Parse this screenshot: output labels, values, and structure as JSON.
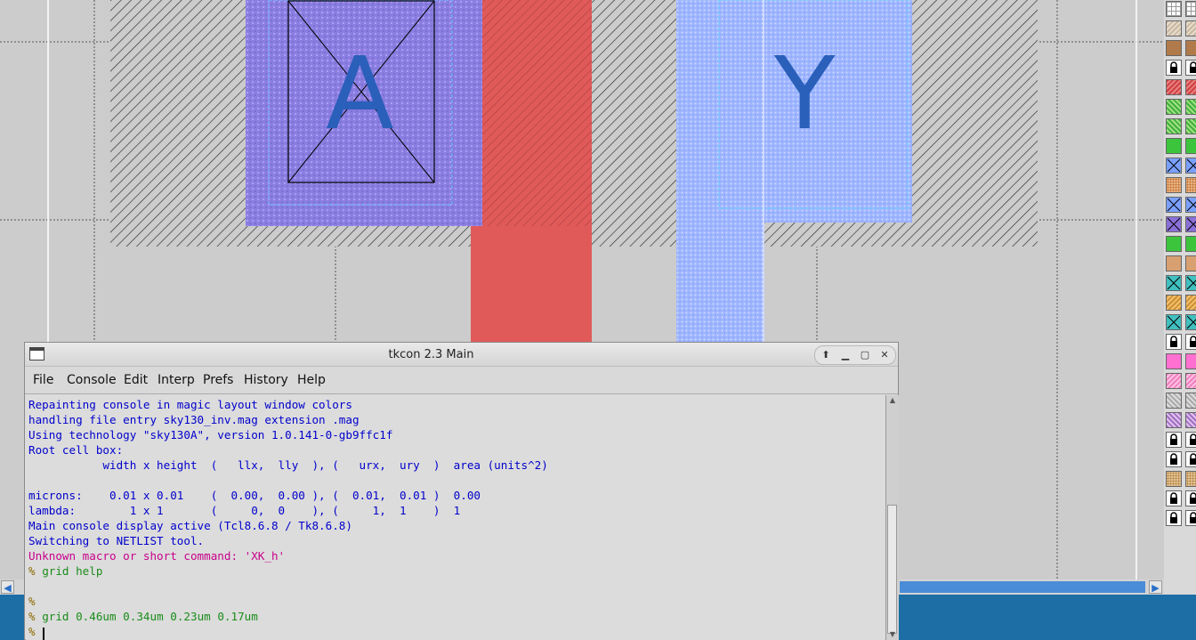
{
  "layout": {
    "labels": {
      "pin_a": "A",
      "pin_y": "Y"
    },
    "colors": {
      "background": "#cccccc",
      "poly": "#e05a5a",
      "metal1": "#aab8ff",
      "li": "#8877dd",
      "text": "#2a5fba"
    }
  },
  "palette": {
    "tiles": [
      {
        "kind": "grid-icon"
      },
      {
        "kind": "hatch-tan"
      },
      {
        "kind": "brown"
      },
      {
        "kind": "lock-icon"
      },
      {
        "kind": "red-hatch"
      },
      {
        "kind": "green-hatch"
      },
      {
        "kind": "green-hatch"
      },
      {
        "kind": "green"
      },
      {
        "kind": "blue-x"
      },
      {
        "kind": "orange-dots"
      },
      {
        "kind": "blue-x"
      },
      {
        "kind": "purple-x"
      },
      {
        "kind": "green"
      },
      {
        "kind": "tan"
      },
      {
        "kind": "teal-x"
      },
      {
        "kind": "orange-hatch"
      },
      {
        "kind": "teal-x"
      },
      {
        "kind": "lock-icon"
      },
      {
        "kind": "pink"
      },
      {
        "kind": "pink-hatch"
      },
      {
        "kind": "grey-hatch"
      },
      {
        "kind": "purple-hatch"
      },
      {
        "kind": "lock-icon"
      },
      {
        "kind": "lock-icon"
      },
      {
        "kind": "tan-dots"
      },
      {
        "kind": "lock-icon"
      },
      {
        "kind": "lock-icon"
      }
    ]
  },
  "tkcon": {
    "title": "tkcon 2.3 Main",
    "menu": [
      "File",
      "Console",
      "Edit",
      "Interp",
      "Prefs",
      "History",
      "Help"
    ],
    "lines": [
      {
        "text": "Repainting console in magic layout window colors",
        "style": "info"
      },
      {
        "text": "handling file entry sky130_inv.mag extension .mag",
        "style": "info"
      },
      {
        "text": "Using technology \"sky130A\", version 1.0.141-0-gb9ffc1f",
        "style": "info"
      },
      {
        "text": "Root cell box:",
        "style": "info"
      },
      {
        "text": "           width x height  (   llx,  lly  ), (   urx,  ury  )  area (units^2)",
        "style": "info"
      },
      {
        "text": "",
        "style": "info"
      },
      {
        "text": "microns:    0.01 x 0.01    (  0.00,  0.00 ), (  0.01,  0.01 )  0.00",
        "style": "info"
      },
      {
        "text": "lambda:        1 x 1       (     0,  0    ), (     1,  1    )  1",
        "style": "info"
      },
      {
        "text": "Main console display active (Tcl8.6.8 / Tk8.6.8)",
        "style": "info"
      },
      {
        "text": "Switching to NETLIST tool.",
        "style": "info"
      },
      {
        "text": "Unknown macro or short command: 'XK_h'",
        "style": "error"
      }
    ],
    "prompt": "%",
    "commands": [
      "grid help",
      "",
      "grid 0.46um 0.34um 0.23um 0.17um"
    ]
  }
}
